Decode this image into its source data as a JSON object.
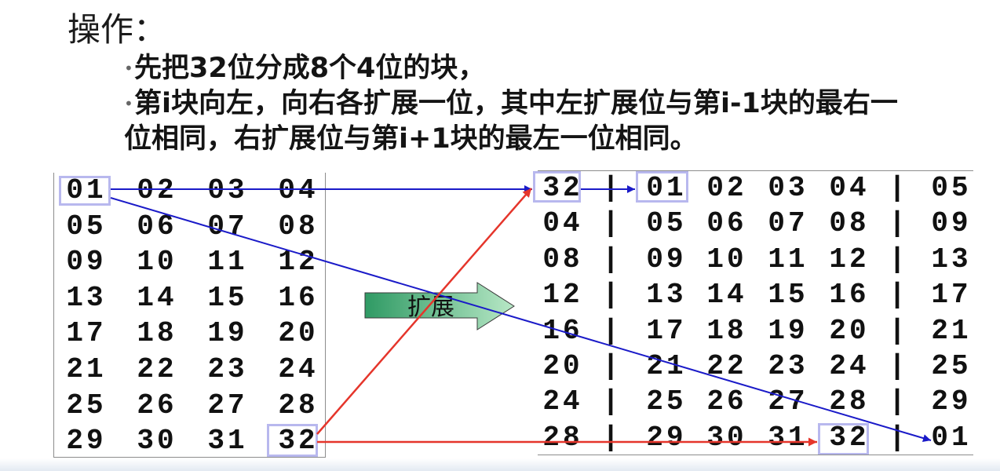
{
  "slide": {
    "title": "操作：",
    "bullet_glyph": "•",
    "bullets": [
      {
        "lines": [
          "先把32位分成8个4位的块，"
        ]
      },
      {
        "lines": [
          "第i块向左，向右各扩展一位，其中左扩展位与第i-1块的最右一",
          "位相同，右扩展位与第i+1块的最左一位相同。"
        ]
      }
    ]
  },
  "diagram": {
    "input_rows": [
      [
        "01",
        "02",
        "03",
        "04"
      ],
      [
        "05",
        "06",
        "07",
        "08"
      ],
      [
        "09",
        "10",
        "11",
        "12"
      ],
      [
        "13",
        "14",
        "15",
        "16"
      ],
      [
        "17",
        "18",
        "19",
        "20"
      ],
      [
        "21",
        "22",
        "23",
        "24"
      ],
      [
        "25",
        "26",
        "27",
        "28"
      ],
      [
        "29",
        "30",
        "31",
        "32"
      ]
    ],
    "expanded_rows": [
      [
        "32",
        "|",
        "01",
        "02",
        "03",
        "04",
        "|",
        "05"
      ],
      [
        "04",
        "|",
        "05",
        "06",
        "07",
        "08",
        "|",
        "09"
      ],
      [
        "08",
        "|",
        "09",
        "10",
        "11",
        "12",
        "|",
        "13"
      ],
      [
        "12",
        "|",
        "13",
        "14",
        "15",
        "16",
        "|",
        "17"
      ],
      [
        "16",
        "|",
        "17",
        "18",
        "19",
        "20",
        "|",
        "21"
      ],
      [
        "20",
        "|",
        "21",
        "22",
        "23",
        "24",
        "|",
        "25"
      ],
      [
        "24",
        "|",
        "25",
        "26",
        "27",
        "28",
        "|",
        "29"
      ],
      [
        "28",
        "|",
        "29",
        "30",
        "31",
        "32",
        "|",
        "01"
      ]
    ],
    "expand_label": "扩展",
    "colors": {
      "highlight_box": "#b8b8ee",
      "wrap_arrow_blue": "#1a1ac8",
      "wrap_arrow_red": "#e5352b",
      "expand_arrow_dark": "#2f9a64",
      "expand_arrow_light": "#b8e8c6",
      "text": "#111111"
    }
  }
}
